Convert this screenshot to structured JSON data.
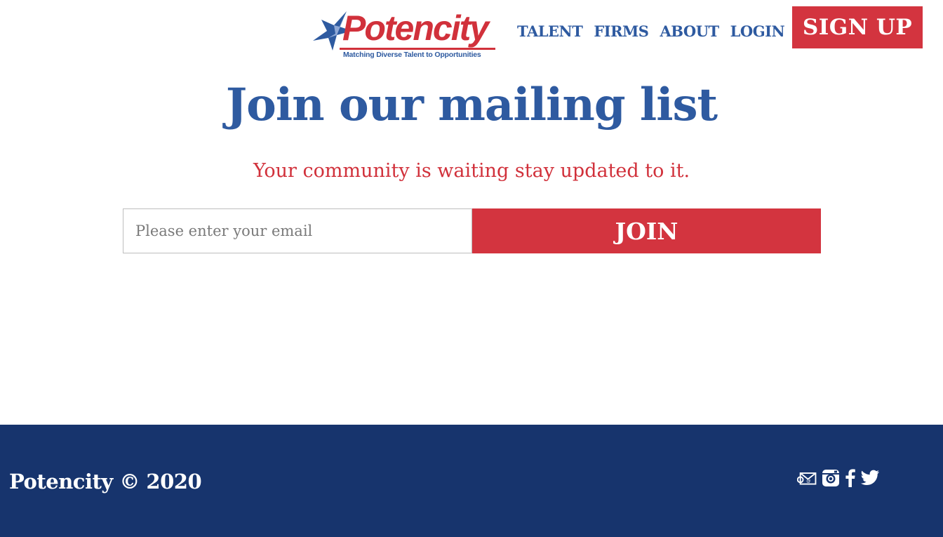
{
  "brand": {
    "name": "Potencity",
    "tagline": "Matching Diverse Talent to Opportunities",
    "colors": {
      "blue": "#2e5aa0",
      "red": "#d3343f",
      "navy": "#17346d"
    }
  },
  "nav": {
    "items": [
      {
        "label": "TALENT"
      },
      {
        "label": "FIRMS"
      },
      {
        "label": "ABOUT"
      },
      {
        "label": "LOGIN"
      }
    ],
    "signup_label": "SIGN UP"
  },
  "main": {
    "title": "Join our mailing list",
    "subtitle": "Your community is waiting stay updated to it.",
    "email_placeholder": "Please enter your email",
    "email_value": "",
    "join_label": "JOIN"
  },
  "footer": {
    "copyright": "Potencity © 2020",
    "social_icons": [
      "email-icon",
      "instagram-icon",
      "facebook-icon",
      "twitter-icon"
    ]
  }
}
